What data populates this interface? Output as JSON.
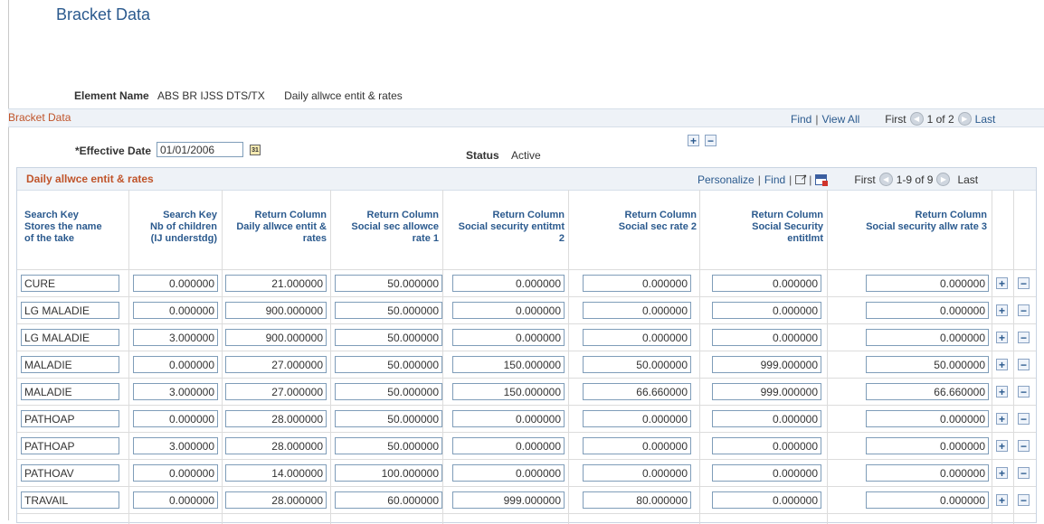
{
  "page": {
    "title": "Bracket Data",
    "element_name_label": "Element Name",
    "element_name": "ABS BR IJSS DTS/TX",
    "element_description": "Daily allwce entit & rates"
  },
  "bracket_bar": {
    "title": "Bracket Data",
    "find": "Find",
    "view_all": "View All",
    "first": "First",
    "position": "1 of 2",
    "last": "Last"
  },
  "effective": {
    "label": "*Effective Date",
    "date": "01/01/2006",
    "status_label": "Status",
    "status": "Active"
  },
  "grid": {
    "title": "Daily allwce entit & rates",
    "personalize": "Personalize",
    "find": "Find",
    "first": "First",
    "position": "1-9 of 9",
    "last": "Last",
    "headers": [
      "Search Key\nStores the name\nof the take",
      "Search Key\nNb of children\n(IJ understdg)",
      "Return Column\nDaily allwce entit &\nrates",
      "Return Column\nSocial sec allowce\nrate 1",
      "Return Column\nSocial security entitmt\n2",
      "Return Column\nSocial sec rate 2",
      "Return Column\nSocial Security\nentitlmt",
      "Return Column\nSocial security allw rate 3"
    ],
    "rows": [
      [
        "CURE",
        "0.000000",
        "21.000000",
        "50.000000",
        "0.000000",
        "0.000000",
        "0.000000",
        "0.000000"
      ],
      [
        "LG MALADIE",
        "0.000000",
        "900.000000",
        "50.000000",
        "0.000000",
        "0.000000",
        "0.000000",
        "0.000000"
      ],
      [
        "LG MALADIE",
        "3.000000",
        "900.000000",
        "50.000000",
        "0.000000",
        "0.000000",
        "0.000000",
        "0.000000"
      ],
      [
        "MALADIE",
        "0.000000",
        "27.000000",
        "50.000000",
        "150.000000",
        "50.000000",
        "999.000000",
        "50.000000"
      ],
      [
        "MALADIE",
        "3.000000",
        "27.000000",
        "50.000000",
        "150.000000",
        "66.660000",
        "999.000000",
        "66.660000"
      ],
      [
        "PATHOAP",
        "0.000000",
        "28.000000",
        "50.000000",
        "0.000000",
        "0.000000",
        "0.000000",
        "0.000000"
      ],
      [
        "PATHOAP",
        "3.000000",
        "28.000000",
        "50.000000",
        "0.000000",
        "0.000000",
        "0.000000",
        "0.000000"
      ],
      [
        "PATHOAV",
        "0.000000",
        "14.000000",
        "100.000000",
        "0.000000",
        "0.000000",
        "0.000000",
        "0.000000"
      ],
      [
        "TRAVAIL",
        "0.000000",
        "28.000000",
        "60.000000",
        "999.000000",
        "80.000000",
        "0.000000",
        "0.000000"
      ]
    ]
  },
  "icons": {
    "add": "+",
    "remove": "−",
    "calendar": "31",
    "prev": "◀",
    "next": "▶"
  }
}
